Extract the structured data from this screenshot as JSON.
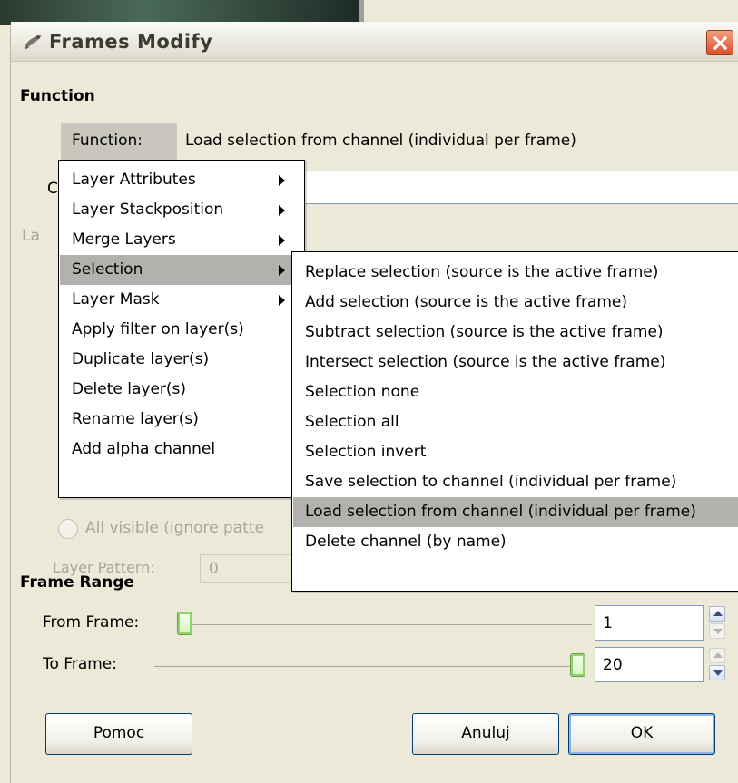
{
  "window": {
    "title": "Frames Modify",
    "icon": "gimp-icon",
    "close": "close-icon"
  },
  "function_section": {
    "heading": "Function",
    "button_label": "Function:",
    "current_value": "Load selection from channel (individual per frame)"
  },
  "background_fragments": {
    "layer_label_fragment": "La",
    "entry_label_fragment": "C",
    "radio_all_visible": "All visible (ignore patte",
    "layer_pattern_label": "Layer Pattern:",
    "layer_pattern_value": "0"
  },
  "main_menu": {
    "items": [
      {
        "label": "Layer Attributes",
        "submenu": true,
        "highlighted": false
      },
      {
        "label": "Layer Stackposition",
        "submenu": true,
        "highlighted": false
      },
      {
        "label": "Merge Layers",
        "submenu": true,
        "highlighted": false
      },
      {
        "label": "Selection",
        "submenu": true,
        "highlighted": true
      },
      {
        "label": "Layer Mask",
        "submenu": true,
        "highlighted": false
      },
      {
        "label": "Apply filter on layer(s)",
        "submenu": false,
        "highlighted": false
      },
      {
        "label": "Duplicate layer(s)",
        "submenu": false,
        "highlighted": false
      },
      {
        "label": "Delete layer(s)",
        "submenu": false,
        "highlighted": false
      },
      {
        "label": "Rename layer(s)",
        "submenu": false,
        "highlighted": false
      },
      {
        "label": "Add alpha channel",
        "submenu": false,
        "highlighted": false
      }
    ]
  },
  "selection_submenu": {
    "items": [
      {
        "label": "Replace selection (source is the active frame)",
        "highlighted": false
      },
      {
        "label": "Add selection (source is the active frame)",
        "highlighted": false
      },
      {
        "label": "Subtract selection (source is the active frame)",
        "highlighted": false
      },
      {
        "label": "Intersect selection (source is the active frame)",
        "highlighted": false
      },
      {
        "label": "Selection none",
        "highlighted": false
      },
      {
        "label": "Selection all",
        "highlighted": false
      },
      {
        "label": "Selection invert",
        "highlighted": false
      },
      {
        "label": "Save selection to channel (individual per frame)",
        "highlighted": false
      },
      {
        "label": "Load selection from channel (individual per frame)",
        "highlighted": true
      },
      {
        "label": "Delete channel (by name)",
        "highlighted": false
      }
    ]
  },
  "frame_range": {
    "heading": "Frame Range",
    "from_label": "From Frame:",
    "from_value": "1",
    "to_label": "To Frame:",
    "to_value": "20",
    "min": 1,
    "max": 20
  },
  "buttons": {
    "help": "Pomoc",
    "cancel": "Anuluj",
    "ok": "OK"
  },
  "colors": {
    "dialog_bg": "#ece9d8",
    "menu_highlight": "#b3b1ae",
    "close_button": "#d8502a"
  }
}
